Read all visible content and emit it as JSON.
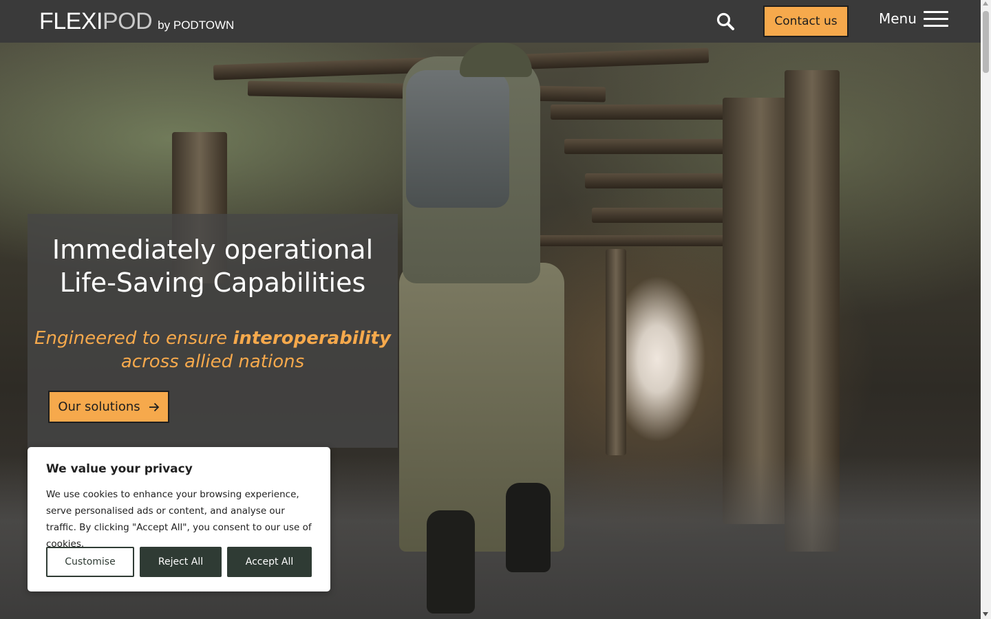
{
  "header": {
    "logo_main_left": "FLEXI",
    "logo_main_right": "POD",
    "logo_by": "by PODTOWN",
    "search_icon": "search-icon",
    "contact_label": "Contact us",
    "menu_label": "Menu",
    "menu_icon": "hamburger-icon"
  },
  "hero": {
    "title_line1": "Immediately operational",
    "title_line2": "Life-Saving Capabilities",
    "subtitle_part1": "Engineered to ensure ",
    "subtitle_bold": "interoperability",
    "subtitle_part2": "across allied nations",
    "cta_label": "Our solutions",
    "cta_icon": "arrow-right-icon"
  },
  "cookie": {
    "title": "We value your privacy",
    "text": "We use cookies to enhance your browsing experience, serve personalised ads or content, and analyse our traffic. By clicking \"Accept All\", you consent to our use of cookies.",
    "customise_label": "Customise",
    "reject_label": "Reject All",
    "accept_label": "Accept All"
  },
  "colors": {
    "accent": "#f6a94c",
    "header_bg": "#3a3a3a",
    "cookie_button": "#2f3b34"
  }
}
